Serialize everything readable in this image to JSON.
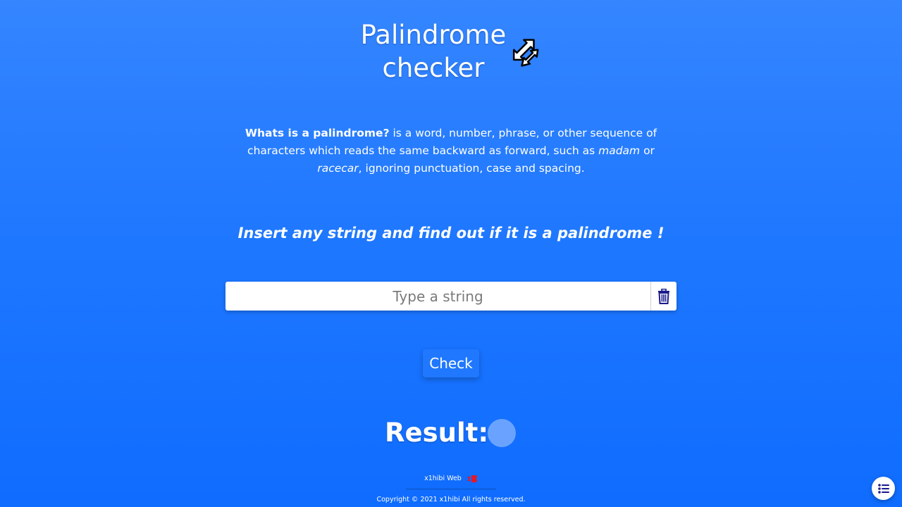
{
  "header": {
    "title_line1": "Palindrome",
    "title_line2": "checker",
    "icon": "swap-arrows-icon"
  },
  "description": {
    "lead": "Whats is a palindrome?",
    "text1": " is a word, number, phrase, or other sequence of characters which reads the same backward as forward, such as ",
    "example1": "madam",
    "text2": " or ",
    "example2": "racecar",
    "text3": ", ignoring punctuation, case and spacing."
  },
  "prompt": "Insert any string and find out if it is a palindrome !",
  "input": {
    "value": "",
    "placeholder": "Type a string",
    "clear_icon": "trash-icon"
  },
  "check_button": "Check",
  "result": {
    "label": "Result:",
    "indicator_color": "#6aa3ff"
  },
  "footer": {
    "brand": "x1hibi Web",
    "copyright": "Copyright © 2021 x1hibi All rights reserved."
  },
  "menu_button": {
    "icon": "list-icon"
  },
  "colors": {
    "background_top": "#3585ff",
    "background_bottom": "#0f6cff",
    "accent": "#1f78ff",
    "icon_dark": "#1a1a8c",
    "brand_red": "#e0192b"
  }
}
